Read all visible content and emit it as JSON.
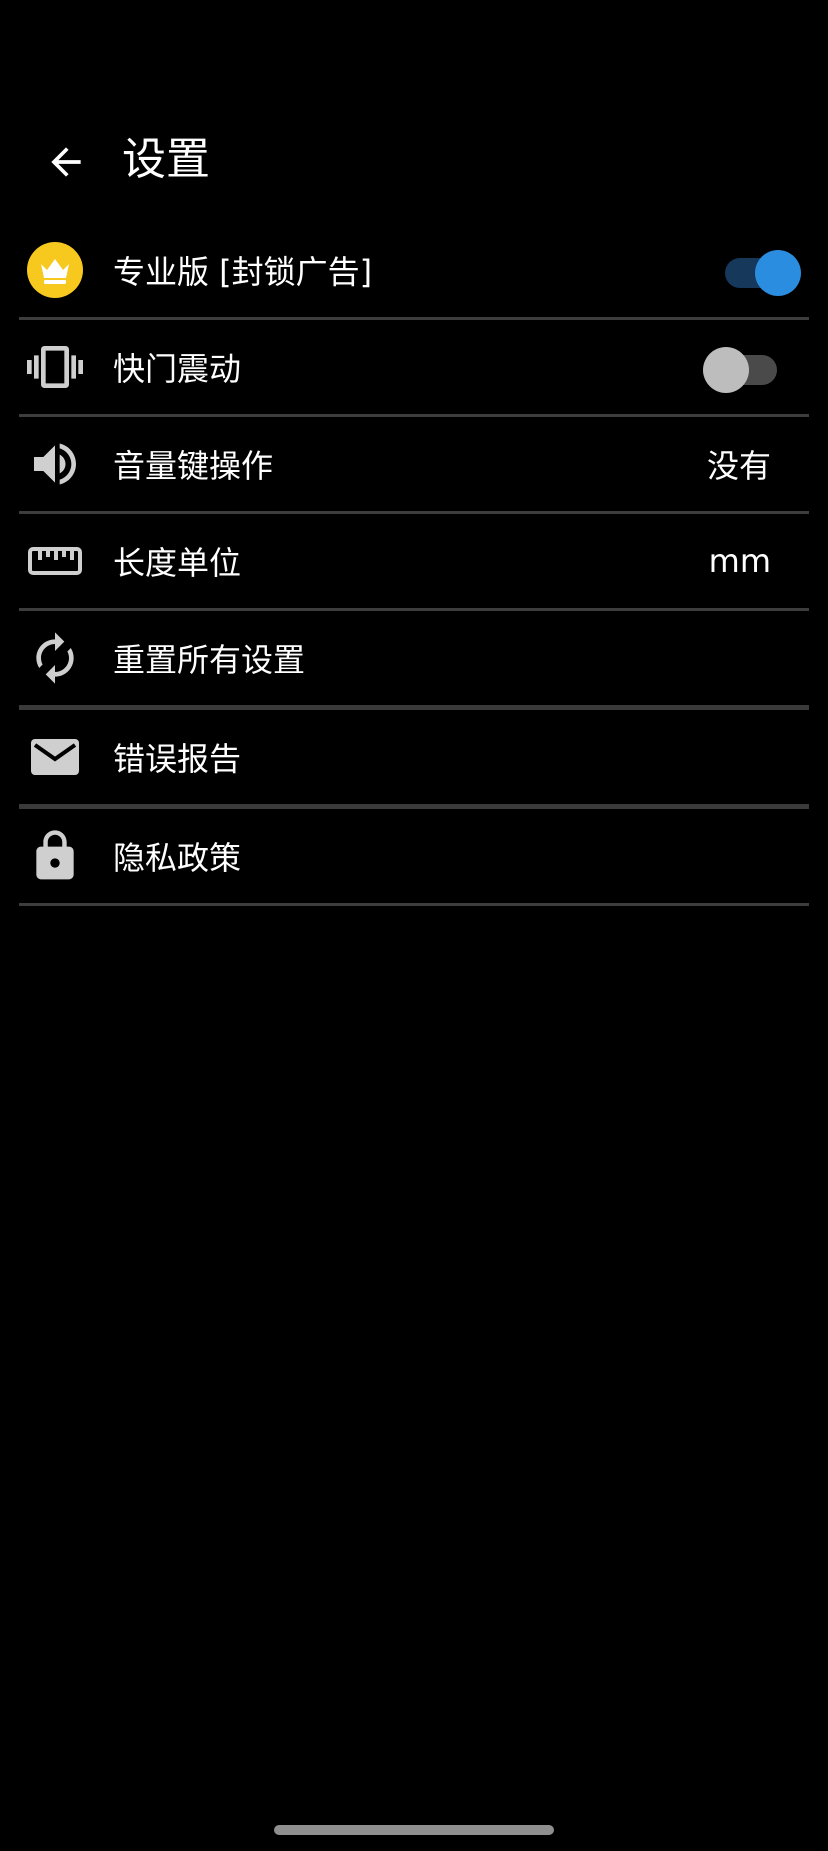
{
  "header": {
    "title": "设置",
    "back_icon": "arrow-back-icon"
  },
  "rows": [
    {
      "label": "专业版 [封锁广告]",
      "icon": "crown-icon",
      "control": "switch",
      "on": true
    },
    {
      "label": "快门震动",
      "icon": "vibration-icon",
      "control": "switch",
      "on": false
    },
    {
      "label": "音量键操作",
      "icon": "volume-icon",
      "control": "value",
      "value": "没有"
    },
    {
      "label": "长度单位",
      "icon": "ruler-icon",
      "control": "value",
      "value": "mm"
    },
    {
      "label": "重置所有设置",
      "icon": "reset-icon",
      "control": "none"
    },
    {
      "label": "错误报告",
      "icon": "mail-icon",
      "control": "none"
    },
    {
      "label": "隐私政策",
      "icon": "lock-icon",
      "control": "none"
    }
  ],
  "colors": {
    "background": "#000000",
    "divider": "#3d3d3d",
    "accent": "#2a8de0",
    "crown_badge": "#f7c81d",
    "icon_gray": "#cfcfcf"
  }
}
